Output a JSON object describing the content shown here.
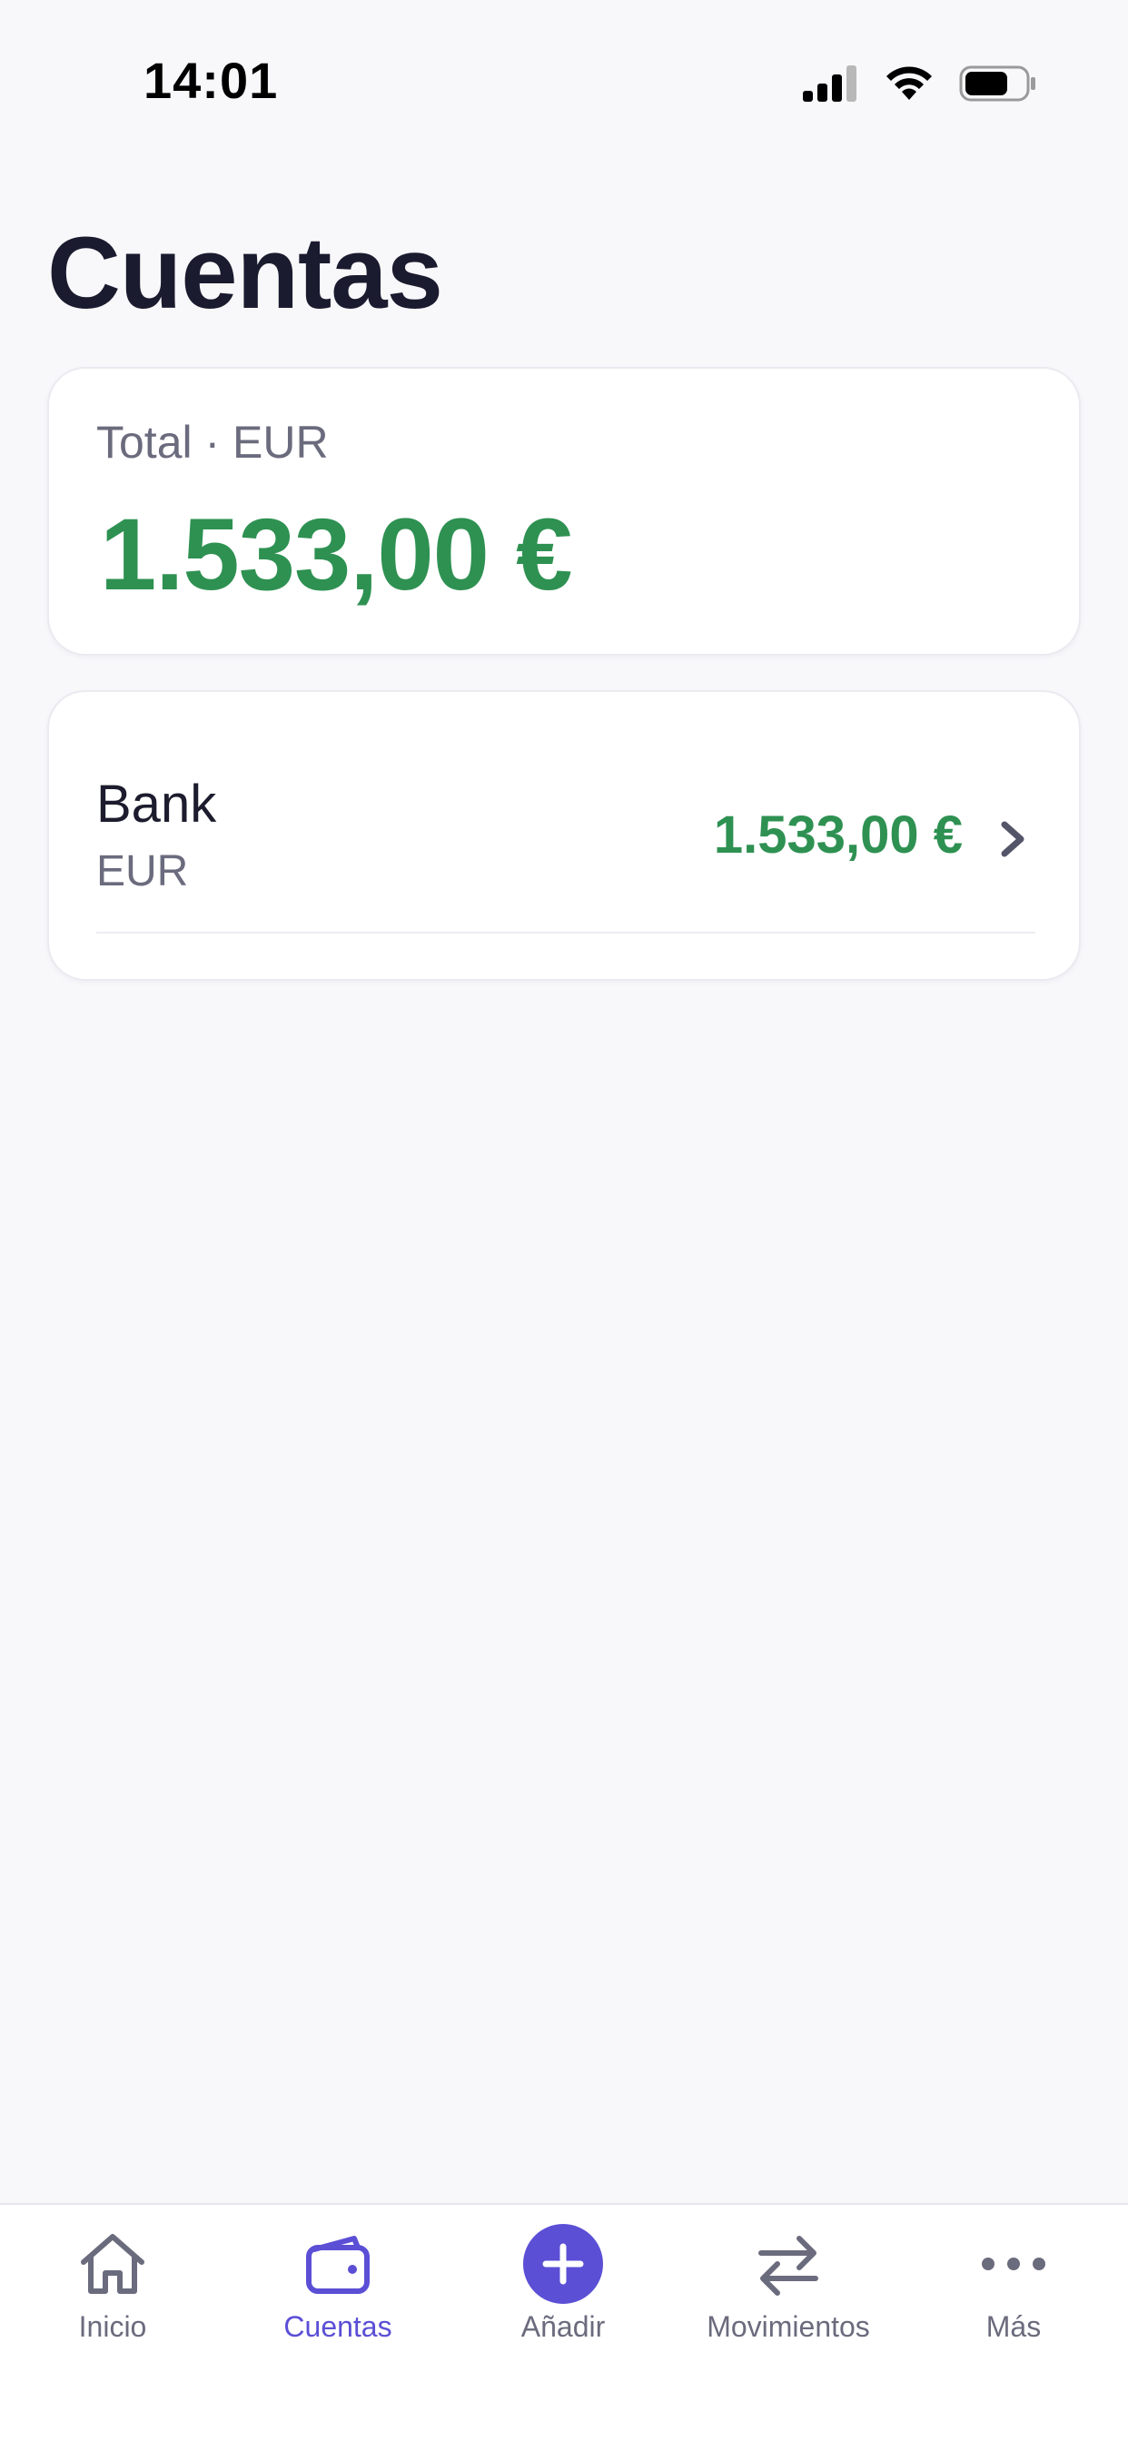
{
  "status_bar": {
    "time": "14:01"
  },
  "page": {
    "title": "Cuentas"
  },
  "total_card": {
    "label": "Total · EUR",
    "value": "1.533,00 €"
  },
  "accounts": [
    {
      "name": "Bank",
      "currency": "EUR",
      "amount": "1.533,00 €"
    }
  ],
  "tab_bar": {
    "active": "Cuentas",
    "items": [
      {
        "label": "Inicio",
        "icon": "home-icon"
      },
      {
        "label": "Cuentas",
        "icon": "wallet-icon"
      },
      {
        "label": "Añadir",
        "icon": "plus-icon"
      },
      {
        "label": "Movimientos",
        "icon": "swap-arrows-icon"
      },
      {
        "label": "Más",
        "icon": "more-dots-icon"
      }
    ]
  },
  "colors": {
    "background": "#F8F8FB",
    "positive": "#2E9152",
    "accent": "#5B4FD6",
    "muted_text": "#6B6B7E",
    "title_text": "#1B1B2F"
  }
}
